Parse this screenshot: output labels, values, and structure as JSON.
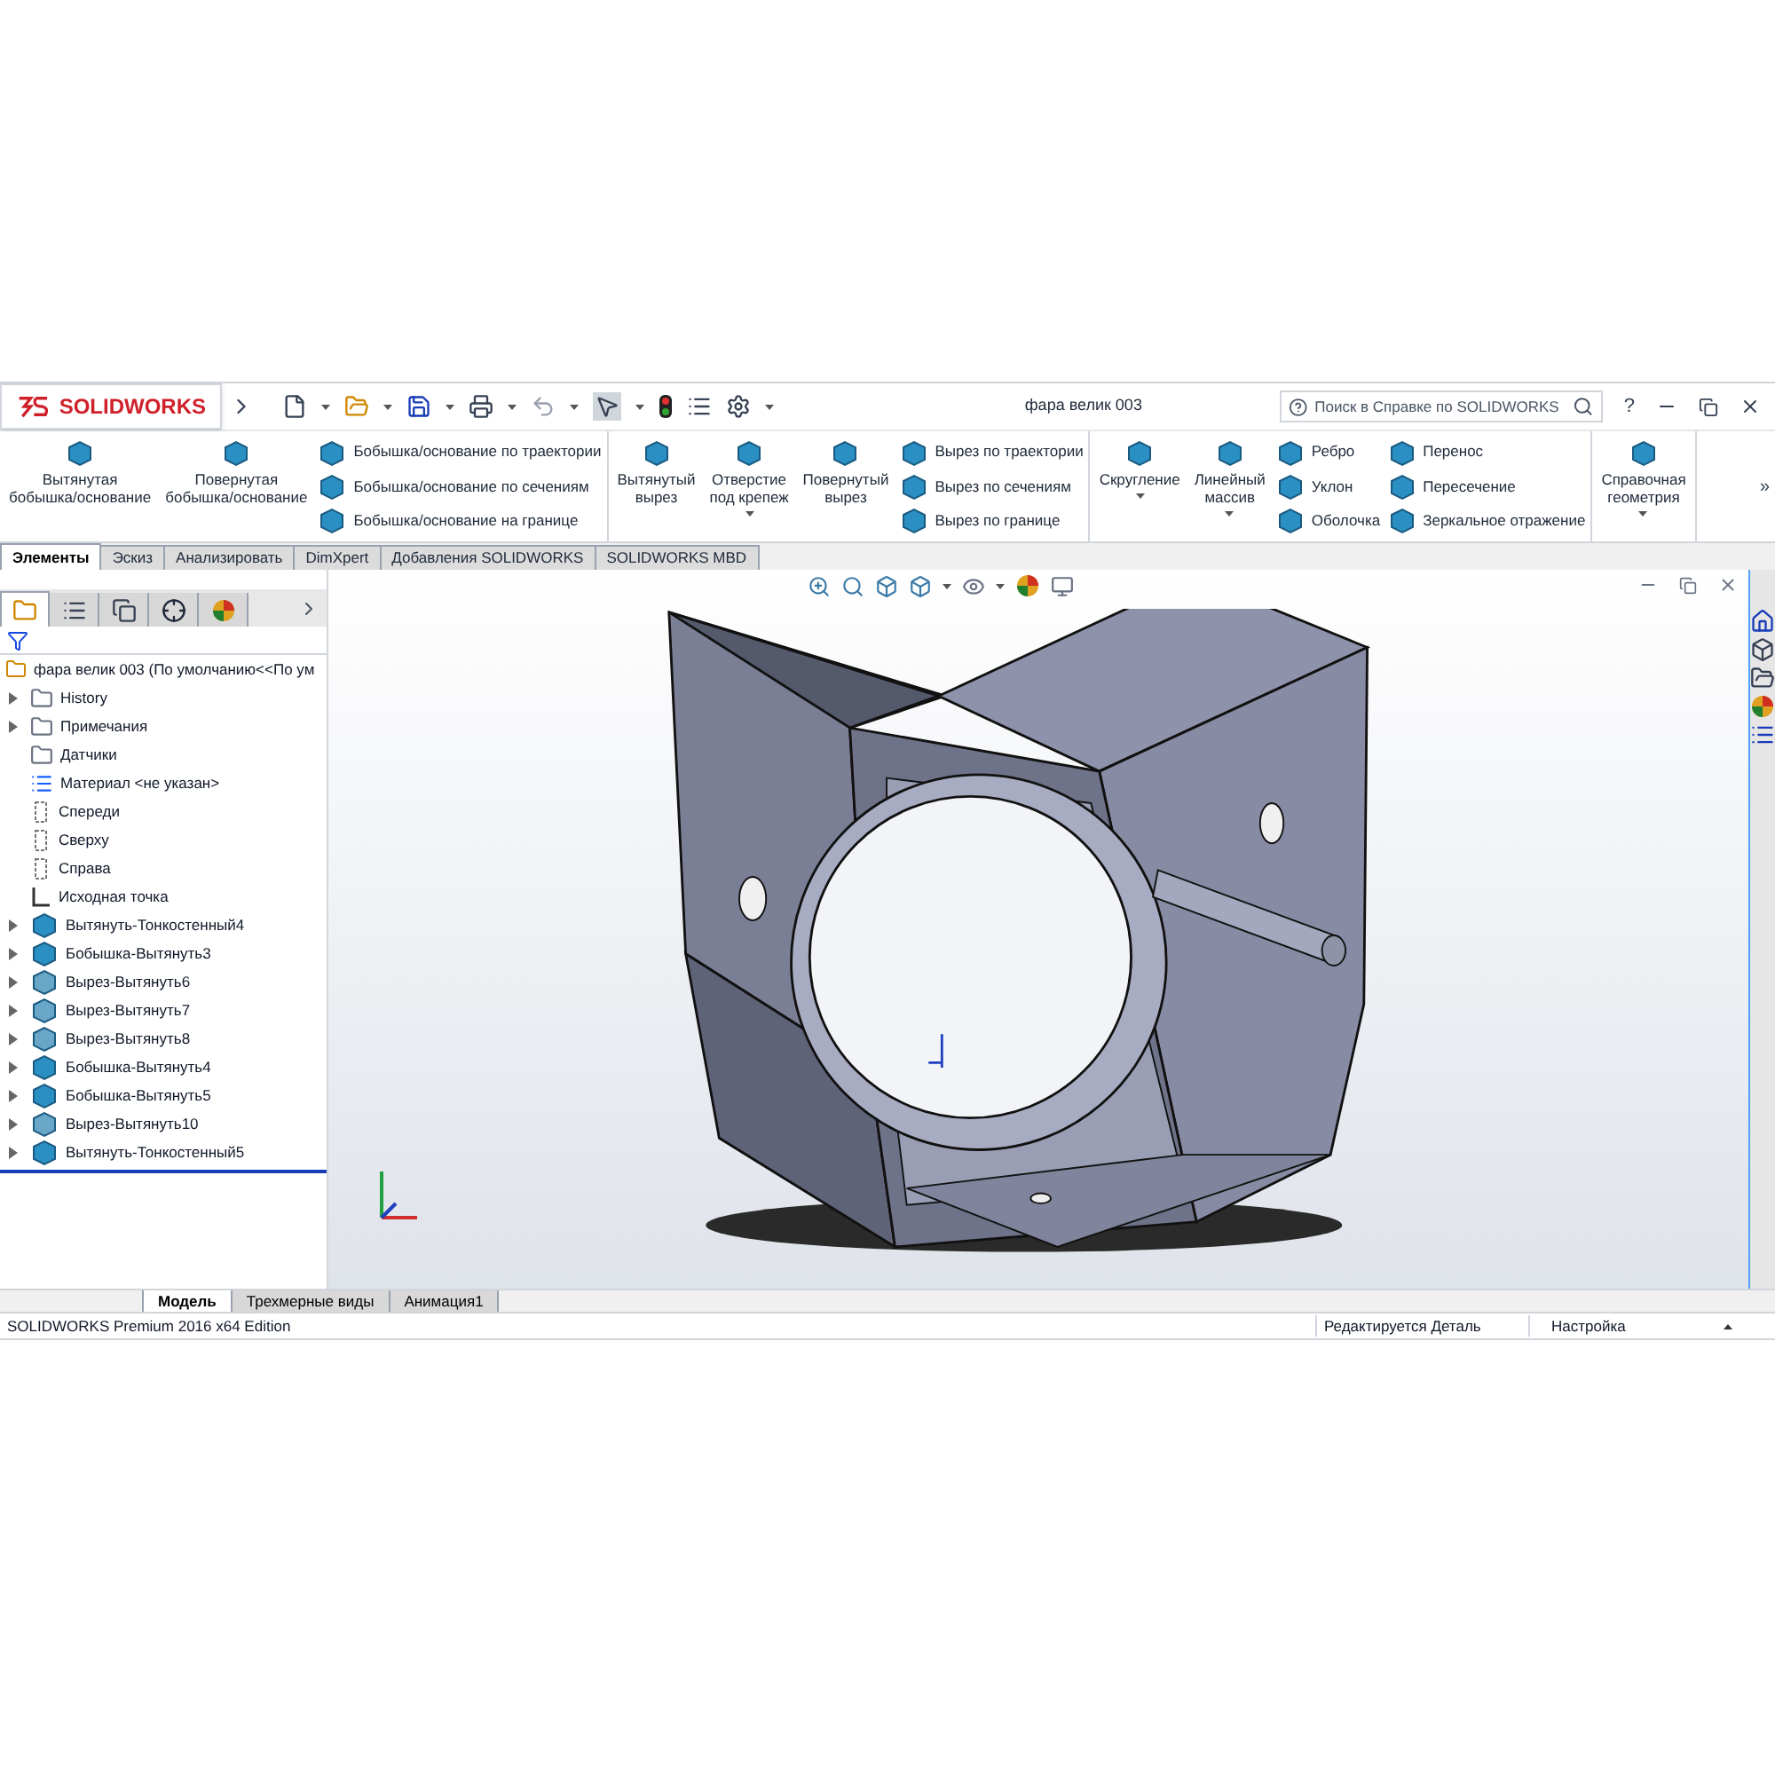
{
  "title_bar": {
    "app_name": "SOLIDWORKS",
    "document_title": "фара велик 003",
    "search": {
      "placeholder": "Поиск в Справке по SOLIDWORKS"
    },
    "help": "?"
  },
  "command_manager": {
    "groups": [
      {
        "items": [
          {
            "kind": "large",
            "label": "Вытянутая\nбобышка/основание",
            "dropdown": false
          },
          {
            "kind": "large",
            "label": "Повернутая\nбобышка/основание",
            "dropdown": false
          },
          {
            "kind": "stack",
            "labels": [
              "Бобышка/основание по траектории",
              "Бобышка/основание по сечениям",
              "Бобышка/основание на границе"
            ]
          }
        ]
      },
      {
        "items": [
          {
            "kind": "large",
            "label": "Вытянутый\nвырез",
            "dropdown": false
          },
          {
            "kind": "large",
            "label": "Отверстие\nпод крепеж",
            "dropdown": true
          },
          {
            "kind": "large",
            "label": "Повернутый\nвырез",
            "dropdown": false
          },
          {
            "kind": "stack",
            "labels": [
              "Вырез по траектории",
              "Вырез по сечениям",
              "Вырез по границе"
            ]
          }
        ]
      },
      {
        "items": [
          {
            "kind": "large",
            "label": "Скругление",
            "dropdown": true
          },
          {
            "kind": "large",
            "label": "Линейный\nмассив",
            "dropdown": true
          },
          {
            "kind": "stack",
            "labels": [
              "Ребро",
              "Уклон",
              "Оболочка"
            ]
          },
          {
            "kind": "stack",
            "labels": [
              "Перенос",
              "Пересечение",
              "Зеркальное отражение"
            ]
          }
        ]
      },
      {
        "items": [
          {
            "kind": "large",
            "label": "Справочная\nгеометрия",
            "dropdown": true
          }
        ]
      }
    ],
    "overflow": "»"
  },
  "tabs": [
    {
      "label": "Элементы",
      "selected": true
    },
    {
      "label": "Эскиз",
      "selected": false
    },
    {
      "label": "Анализировать",
      "selected": false
    },
    {
      "label": "DimXpert",
      "selected": false
    },
    {
      "label": "Добавления SOLIDWORKS",
      "selected": false
    },
    {
      "label": "SOLIDWORKS MBD",
      "selected": false
    }
  ],
  "panel_tabs": [
    {
      "kind": "tree",
      "selected": true
    },
    {
      "kind": "properties",
      "selected": false
    },
    {
      "kind": "config",
      "selected": false
    },
    {
      "kind": "dimxpert",
      "selected": false
    },
    {
      "kind": "display",
      "selected": false
    }
  ],
  "tree": {
    "root": "фара велик 003  (По умолчанию<<По ум",
    "items": [
      {
        "label": "History",
        "kind": "history",
        "expandable": true
      },
      {
        "label": "Примечания",
        "kind": "annotations",
        "expandable": true
      },
      {
        "label": "Датчики",
        "kind": "sensors",
        "expandable": false
      },
      {
        "label": "Материал <не указан>",
        "kind": "material",
        "expandable": false
      },
      {
        "label": "Спереди",
        "kind": "plane",
        "expandable": false
      },
      {
        "label": "Сверху",
        "kind": "plane",
        "expandable": false
      },
      {
        "label": "Справа",
        "kind": "plane",
        "expandable": false
      },
      {
        "label": "Исходная точка",
        "kind": "origin",
        "expandable": false
      },
      {
        "label": "Вытянуть-Тонкостенный4",
        "kind": "boss",
        "expandable": true
      },
      {
        "label": "Бобышка-Вытянуть3",
        "kind": "boss",
        "expandable": true
      },
      {
        "label": "Вырез-Вытянуть6",
        "kind": "cut",
        "expandable": true
      },
      {
        "label": "Вырез-Вытянуть7",
        "kind": "cut",
        "expandable": true
      },
      {
        "label": "Вырез-Вытянуть8",
        "kind": "cut",
        "expandable": true
      },
      {
        "label": "Бобышка-Вытянуть4",
        "kind": "boss",
        "expandable": true
      },
      {
        "label": "Бобышка-Вытянуть5",
        "kind": "boss",
        "expandable": true
      },
      {
        "label": "Вырез-Вытянуть10",
        "kind": "cut",
        "expandable": true
      },
      {
        "label": "Вытянуть-Тонкостенный5",
        "kind": "boss",
        "expandable": true
      }
    ]
  },
  "bottom_tabs": [
    {
      "label": "Модель",
      "selected": true
    },
    {
      "label": "Трехмерные виды",
      "selected": false
    },
    {
      "label": "Анимация1",
      "selected": false
    }
  ],
  "status_bar": {
    "edition": "SOLIDWORKS Premium 2016 x64 Edition",
    "mode": "Редактируется Деталь",
    "settings": "Настройка"
  }
}
